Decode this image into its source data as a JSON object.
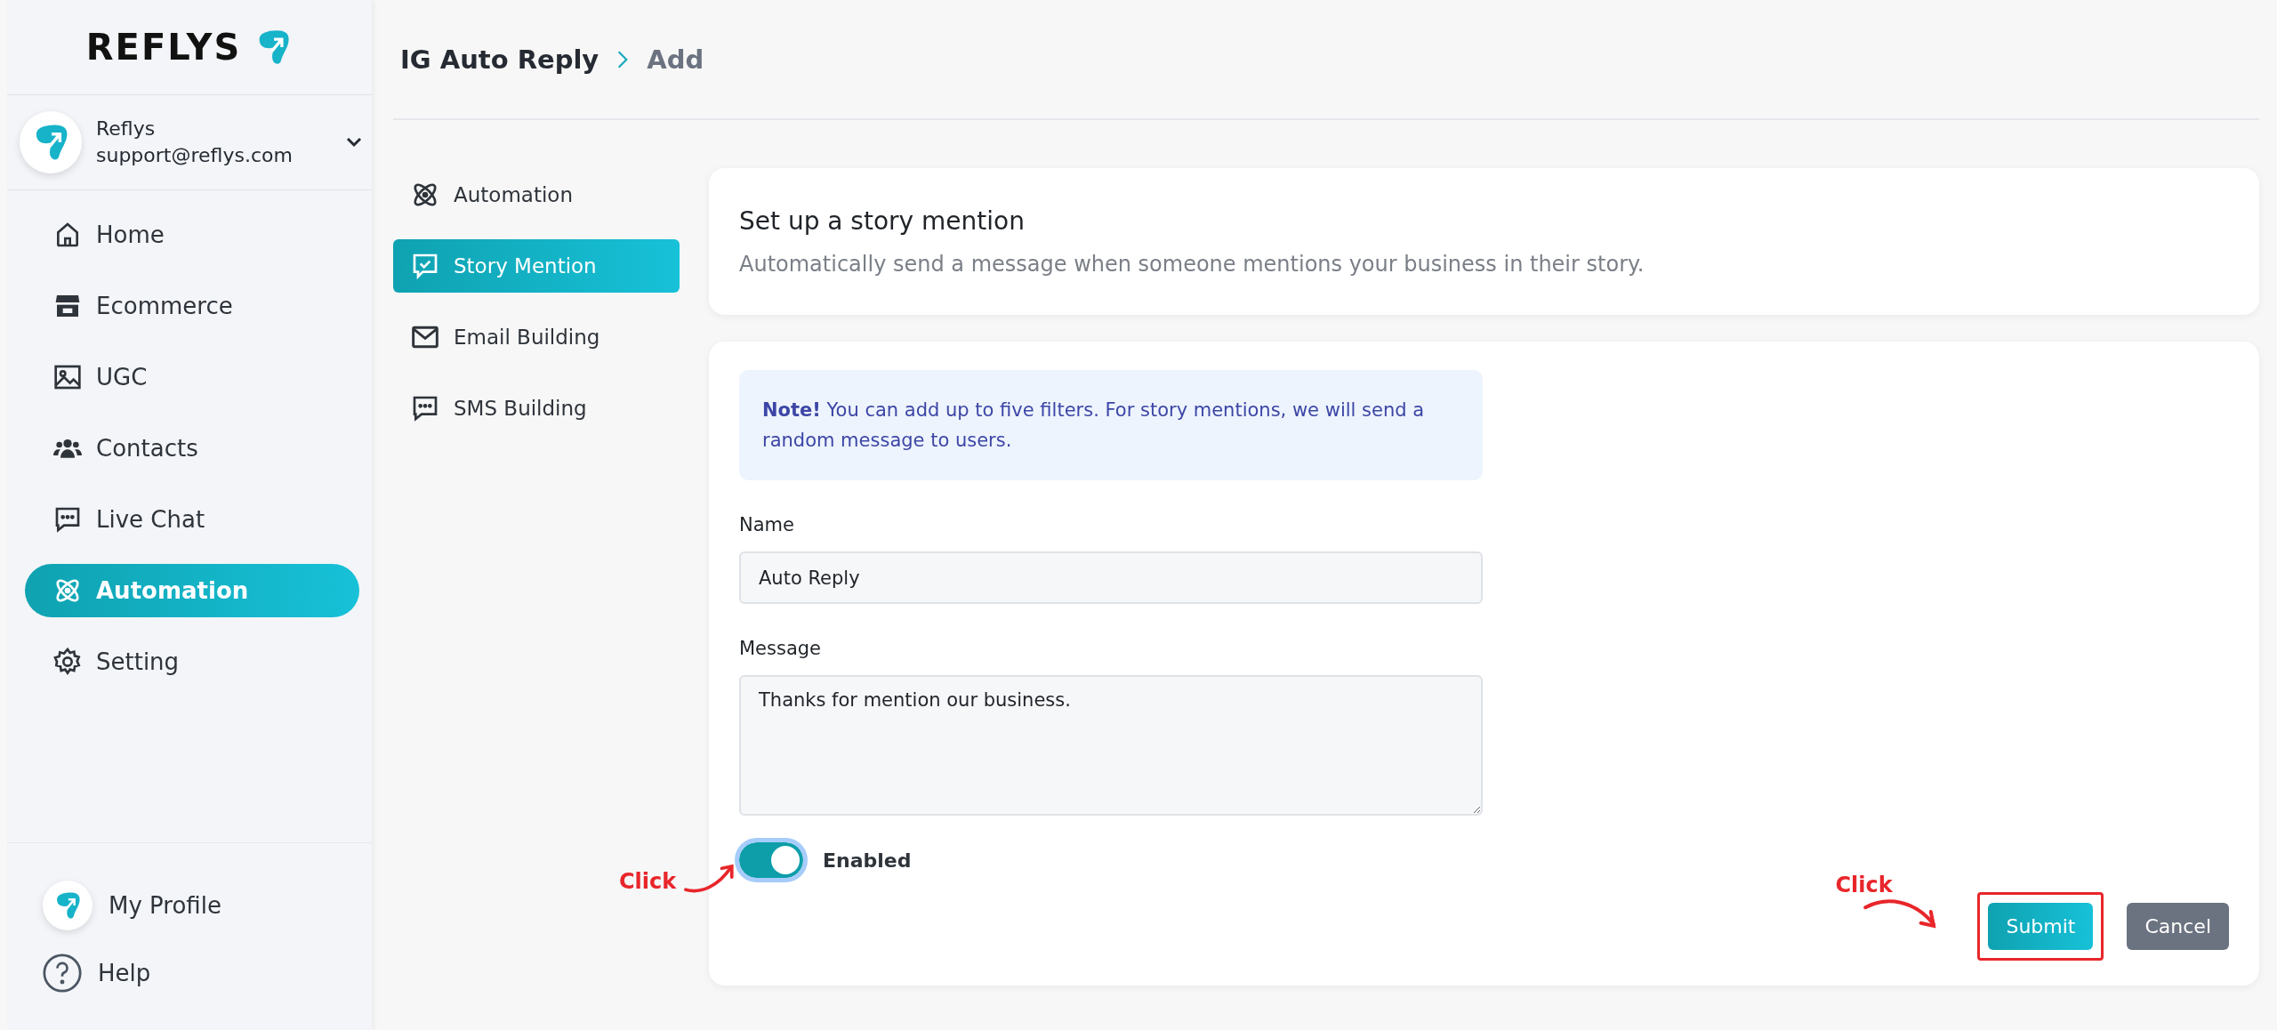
{
  "logo": {
    "text": "REFLYS"
  },
  "account": {
    "name": "Reflys",
    "email": "support@reflys.com"
  },
  "nav": [
    {
      "label": "Home",
      "kind": "home",
      "selected": false
    },
    {
      "label": "Ecommerce",
      "kind": "store",
      "selected": false
    },
    {
      "label": "UGC",
      "kind": "image",
      "selected": false
    },
    {
      "label": "Contacts",
      "kind": "people",
      "selected": false
    },
    {
      "label": "Live Chat",
      "kind": "chat",
      "selected": false
    },
    {
      "label": "Automation",
      "kind": "atom",
      "selected": true
    },
    {
      "label": "Setting",
      "kind": "gear",
      "selected": false
    }
  ],
  "footer_nav": [
    {
      "label": "My Profile",
      "kind": "avatar"
    },
    {
      "label": "Help",
      "kind": "help"
    }
  ],
  "breadcrumb": {
    "parent": "IG Auto Reply",
    "current": "Add"
  },
  "subnav": [
    {
      "label": "Automation",
      "kind": "atom",
      "selected": false
    },
    {
      "label": "Story Mention",
      "kind": "check-chat",
      "selected": true
    },
    {
      "label": "Email Building",
      "kind": "mail",
      "selected": false
    },
    {
      "label": "SMS Building",
      "kind": "chat",
      "selected": false
    }
  ],
  "header_card": {
    "title": "Set up a story mention",
    "description": "Automatically send a message when someone mentions your business in their story."
  },
  "note": {
    "text": "**Note!** You can add up to five filters. For story mentions, we will send a random message to users."
  },
  "form": {
    "fields": [
      {
        "label": "Name",
        "kind": "input",
        "value": "Auto Reply"
      },
      {
        "label": "Message",
        "kind": "textarea",
        "value": "Thanks for mention our business."
      }
    ],
    "toggle": {
      "label": "Enabled",
      "on": true,
      "annotation": "Click"
    },
    "buttons": [
      {
        "label": "Submit",
        "kind": "primary",
        "highlighted": true,
        "annotation": "Click"
      },
      {
        "label": "Cancel",
        "kind": "secondary",
        "highlighted": false
      }
    ]
  }
}
